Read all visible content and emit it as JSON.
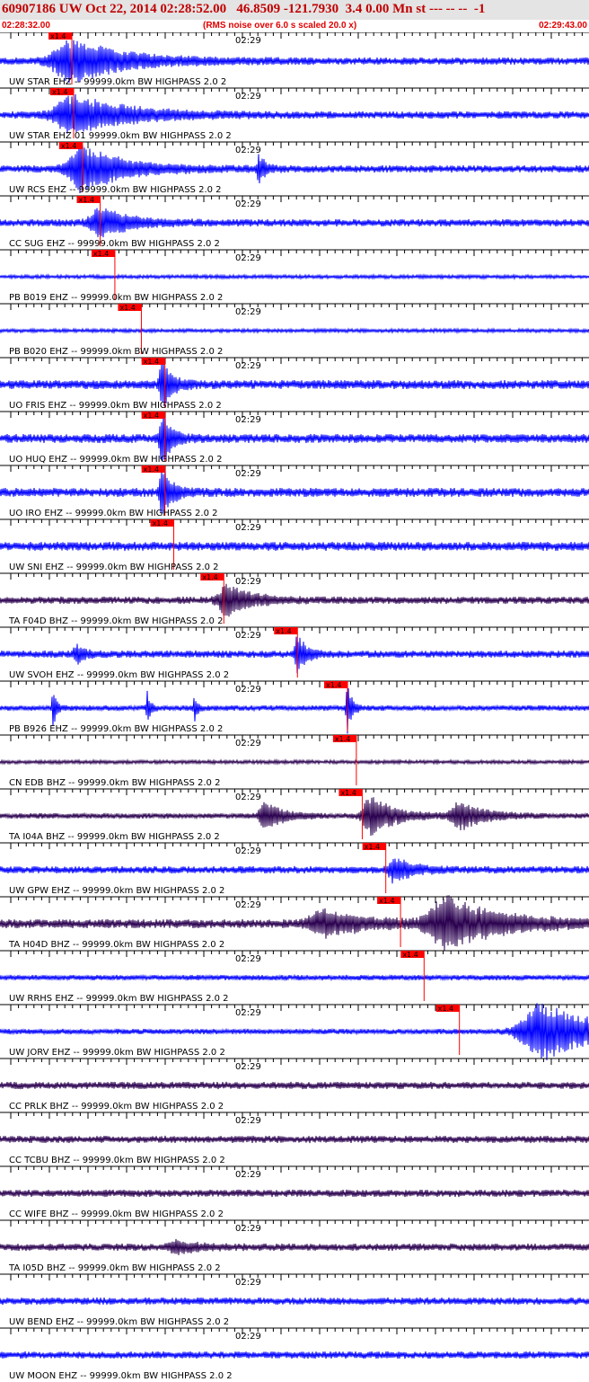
{
  "header": {
    "title": "60907186 UW Oct 22, 2014 02:28:52.00   46.8509 -121.7930  3.4 0.00 Mn st --- -- --  -1",
    "start_time": "02:28:32.00",
    "note": "(RMS noise over 6.0 s scaled 20.0 x)",
    "end_time": "02:29:43.00"
  },
  "tick_time_label": "02:29",
  "pick_label": "x1.4",
  "colors": {
    "blue": "#0000ff",
    "dark": "#2a004f",
    "pick": "#ff0000",
    "axis": "#000000"
  },
  "channels": [
    {
      "label": "UW STAR EHZ -- 99999.0km BW  HIGHPASS  2.0  2",
      "color": "blue",
      "pick": 0.122,
      "amp": 4,
      "bursts": [
        [
          0.122,
          0.09,
          24
        ]
      ]
    },
    {
      "label": "UW STAR EHZ 01 99999.0km BW  HIGHPASS  2.0  2",
      "color": "blue",
      "pick": 0.125,
      "amp": 4,
      "bursts": [
        [
          0.126,
          0.09,
          22
        ]
      ]
    },
    {
      "label": "UW RCS EHZ -- 99999.0km BW  HIGHPASS  2.0  2",
      "color": "blue",
      "pick": 0.14,
      "amp": 4,
      "bursts": [
        [
          0.14,
          0.07,
          26
        ],
        [
          0.44,
          0.01,
          16
        ]
      ]
    },
    {
      "label": "CC SUG EHZ -- 99999.0km BW  HIGHPASS  2.0  2",
      "color": "blue",
      "pick": 0.17,
      "amp": 4,
      "bursts": [
        [
          0.17,
          0.05,
          16
        ]
      ]
    },
    {
      "label": "PB B019 EHZ -- 99999.0km BW  HIGHPASS  2.0  2",
      "color": "blue",
      "pick": 0.195,
      "amp": 2,
      "bursts": []
    },
    {
      "label": "PB B020 EHZ -- 99999.0km BW  HIGHPASS  2.0  2",
      "color": "blue",
      "pick": 0.24,
      "amp": 2,
      "bursts": []
    },
    {
      "label": "UO FRIS EHZ -- 99999.0km BW  HIGHPASS  2.0  2",
      "color": "blue",
      "pick": 0.28,
      "amp": 5,
      "bursts": [
        [
          0.276,
          0.015,
          28
        ]
      ]
    },
    {
      "label": "UO HUQ EHZ -- 99999.0km BW  HIGHPASS  2.0  2",
      "color": "blue",
      "pick": 0.28,
      "amp": 5,
      "bursts": [
        [
          0.276,
          0.015,
          28
        ]
      ]
    },
    {
      "label": "UO IRO EHZ -- 99999.0km BW  HIGHPASS  2.0  2",
      "color": "blue",
      "pick": 0.28,
      "amp": 5,
      "bursts": [
        [
          0.276,
          0.015,
          30
        ]
      ]
    },
    {
      "label": "UW SNI EHZ -- 99999.0km BW  HIGHPASS  2.0  2",
      "color": "blue",
      "pick": 0.295,
      "amp": 5,
      "bursts": []
    },
    {
      "label": "TA F04D BHZ -- 99999.0km BW  HIGHPASS  2.0  2",
      "color": "dark",
      "pick": 0.38,
      "amp": 4,
      "bursts": [
        [
          0.385,
          0.04,
          18
        ]
      ]
    },
    {
      "label": "UW SVOH EHZ -- 99999.0km BW  HIGHPASS  2.0  2",
      "color": "blue",
      "pick": 0.505,
      "amp": 4,
      "bursts": [
        [
          0.13,
          0.015,
          10
        ],
        [
          0.505,
          0.015,
          22
        ]
      ]
    },
    {
      "label": "PB B926 EHZ -- 99999.0km BW  HIGHPASS  2.0  2",
      "color": "blue",
      "pick": 0.59,
      "amp": 3,
      "bursts": [
        [
          0.09,
          0.005,
          24
        ],
        [
          0.25,
          0.005,
          20
        ],
        [
          0.33,
          0.005,
          16
        ],
        [
          0.59,
          0.008,
          28
        ]
      ]
    },
    {
      "label": "CN EDB BHZ -- 99999.0km BW  HIGHPASS  2.0  2",
      "color": "dark",
      "pick": 0.605,
      "amp": 2,
      "bursts": []
    },
    {
      "label": "TA I04A BHZ -- 99999.0km BW  HIGHPASS  2.0  2",
      "color": "dark",
      "pick": 0.615,
      "amp": 3,
      "bursts": [
        [
          0.45,
          0.03,
          16
        ],
        [
          0.63,
          0.04,
          22
        ],
        [
          0.78,
          0.04,
          16
        ]
      ]
    },
    {
      "label": "UW GPW EHZ -- 99999.0km BW  HIGHPASS  2.0  2",
      "color": "blue",
      "pick": 0.655,
      "amp": 4,
      "bursts": [
        [
          0.67,
          0.03,
          14
        ]
      ]
    },
    {
      "label": "TA H04D BHZ -- 99999.0km BW  HIGHPASS  2.0  2",
      "color": "dark",
      "pick": 0.68,
      "amp": 5,
      "bursts": [
        [
          0.55,
          0.07,
          14
        ],
        [
          0.76,
          0.09,
          28
        ]
      ]
    },
    {
      "label": "UW RRHS EHZ -- 99999.0km BW  HIGHPASS  2.0  2",
      "color": "blue",
      "pick": 0.72,
      "amp": 3,
      "bursts": []
    },
    {
      "label": "UW JORV EHZ -- 99999.0km BW  HIGHPASS  2.0  2",
      "color": "blue",
      "pick": 0.78,
      "amp": 3,
      "bursts": [
        [
          0.92,
          0.1,
          32
        ]
      ]
    },
    {
      "label": "CC PRLK BHZ -- 99999.0km BW  HIGHPASS  2.0  2",
      "color": "dark",
      "pick": null,
      "amp": 4,
      "bursts": []
    },
    {
      "label": "CC TCBU BHZ -- 99999.0km BW  HIGHPASS  2.0  2",
      "color": "dark",
      "pick": null,
      "amp": 4,
      "bursts": []
    },
    {
      "label": "CC WIFE BHZ -- 99999.0km BW  HIGHPASS  2.0  2",
      "color": "dark",
      "pick": null,
      "amp": 4,
      "bursts": []
    },
    {
      "label": "TA I05D BHZ -- 99999.0km BW  HIGHPASS  2.0  2",
      "color": "dark",
      "pick": null,
      "amp": 4,
      "bursts": [
        [
          0.3,
          0.04,
          6
        ]
      ]
    },
    {
      "label": "UW BEND EHZ -- 99999.0km BW  HIGHPASS  2.0  2",
      "color": "blue",
      "pick": null,
      "amp": 4,
      "bursts": []
    },
    {
      "label": "UW MOON EHZ -- 99999.0km BW  HIGHPASS  2.0  2",
      "color": "blue",
      "pick": null,
      "amp": 4,
      "bursts": []
    }
  ]
}
